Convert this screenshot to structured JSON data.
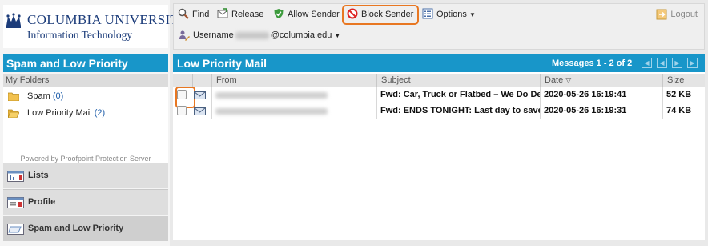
{
  "branding": {
    "line1": "COLUMBIA UNIVERSITY",
    "line2": "Information Technology"
  },
  "left_panel": {
    "title": "Spam and Low Priority",
    "my_folders_label": "My Folders",
    "folders": [
      {
        "name": "Spam",
        "count": "(0)",
        "icon": "folder-closed-icon"
      },
      {
        "name": "Low Priority Mail",
        "count": "(2)",
        "icon": "folder-open-icon"
      }
    ],
    "powered_by": "Powered by Proofpoint Protection Server",
    "nav": [
      {
        "label": "Lists",
        "icon": "lists-icon"
      },
      {
        "label": "Profile",
        "icon": "profile-icon"
      },
      {
        "label": "Spam and Low Priority",
        "icon": "spam-folder-icon",
        "active": true
      }
    ]
  },
  "toolbar": {
    "find": "Find",
    "release": "Release",
    "allow_sender": "Allow Sender",
    "block_sender": "Block Sender",
    "options": "Options",
    "logout": "Logout",
    "username_label": "Username",
    "username_domain": "@columbia.edu"
  },
  "mail": {
    "title": "Low Priority Mail",
    "messages_count": "Messages 1 - 2 of 2",
    "columns": [
      "From",
      "Subject",
      "Date",
      "Size"
    ],
    "rows": [
      {
        "subject": "Fwd: Car, Truck or Flatbed – We Do De",
        "date": "2020-05-26 16:19:41",
        "size": "52 KB"
      },
      {
        "subject": "Fwd: ENDS TONIGHT: Last day to save",
        "date": "2020-05-26 16:19:31",
        "size": "74 KB"
      }
    ]
  },
  "colors": {
    "header_blue": "#1896c9",
    "highlight_orange": "#e87722",
    "brand_navy": "#1c3c7a"
  }
}
